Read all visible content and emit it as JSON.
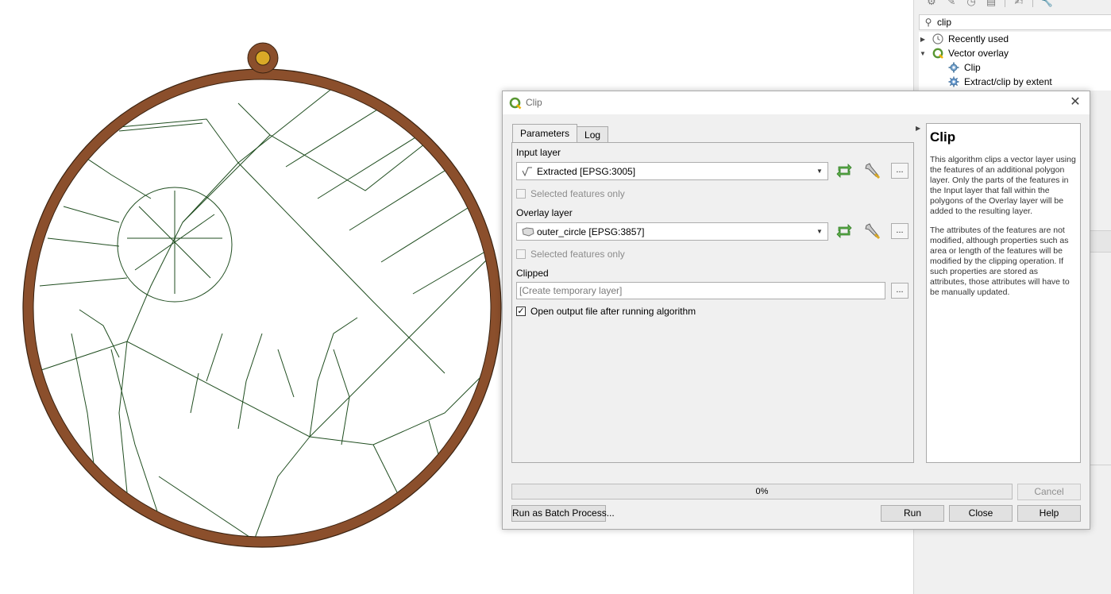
{
  "dialog": {
    "title": "Clip",
    "close_glyph": "✕",
    "tabs": [
      {
        "label": "Parameters",
        "active": true
      },
      {
        "label": "Log",
        "active": false
      }
    ],
    "input_layer": {
      "label": "Input layer",
      "value": "Extracted [EPSG:3005]",
      "icon": "line-layer-icon",
      "selected_only_label": "Selected features only",
      "selected_only_checked": false
    },
    "overlay_layer": {
      "label": "Overlay layer",
      "value": "outer_circle [EPSG:3857]",
      "icon": "polygon-layer-icon",
      "selected_only_label": "Selected features only",
      "selected_only_checked": false
    },
    "output": {
      "label": "Clipped",
      "placeholder": "[Create temporary layer]"
    },
    "open_output": {
      "label": "Open output file after running algorithm",
      "checked": true
    },
    "ellipsis_label": "...",
    "help": {
      "title": "Clip",
      "paragraphs": [
        "This algorithm clips a vector layer using the features of an additional polygon layer. Only the parts of the features in the Input layer that fall within the polygons of the Overlay layer will be added to the resulting layer.",
        "The attributes of the features are not modified, although properties such as area or length of the features will be modified by the clipping operation. If such properties are stored as attributes, those attributes will have to be manually updated."
      ]
    },
    "progress": {
      "value": 0,
      "text": "0%"
    },
    "buttons": {
      "cancel": "Cancel",
      "batch": "Run as Batch Process...",
      "run": "Run",
      "close": "Close",
      "help": "Help"
    }
  },
  "toolbox": {
    "search_value": "clip",
    "tree": [
      {
        "label": "Recently used",
        "icon": "clock-icon",
        "expanded": false
      },
      {
        "label": "Vector overlay",
        "icon": "qgis-icon",
        "expanded": true
      },
      {
        "label": "Clip",
        "icon": "clip-algorithm-icon"
      },
      {
        "label": "Extract/clip by extent",
        "icon": "gear-icon"
      }
    ]
  },
  "colors": {
    "frame_brown": "#8b4f2c",
    "road_green": "#1f4d1f",
    "pin_gold": "#d9a927",
    "qgis_green": "#589632",
    "progress_green": "#06b025"
  }
}
